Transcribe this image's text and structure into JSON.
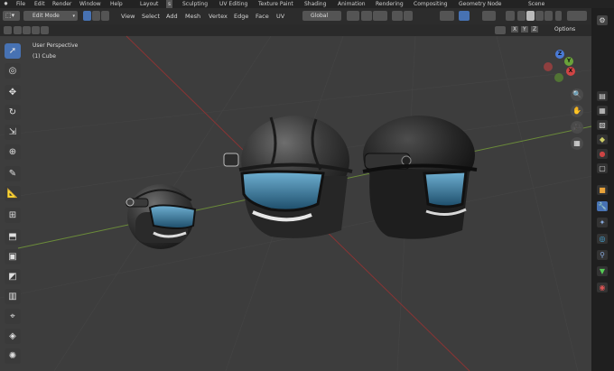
{
  "topbar": {
    "menus": [
      "File",
      "Edit",
      "Render",
      "Window",
      "Help"
    ],
    "workspaces": [
      "Layout",
      "Sculpting",
      "UV Editing",
      "Texture Paint",
      "Shading",
      "Animation",
      "Rendering",
      "Compositing",
      "Geometry Node"
    ],
    "workspace_extra": "s",
    "scene_label": "Scene"
  },
  "header": {
    "mode": "Edit Mode",
    "menus": [
      "View",
      "Select",
      "Add",
      "Mesh",
      "Vertex",
      "Edge",
      "Face",
      "UV"
    ],
    "transform": "Global"
  },
  "subheader": {
    "axes": [
      "X",
      "Y",
      "Z"
    ],
    "options": "Options"
  },
  "viewport": {
    "perspective": "User Perspective",
    "object": "(1) Cube"
  },
  "gizmo": {
    "x": "X",
    "y": "Y",
    "z": "Z"
  },
  "colors": {
    "accent": "#4772b3",
    "bg": "#3d3d3d",
    "grid_x": "#9a3b3b",
    "grid_y": "#6b8b3a"
  },
  "icons": {
    "tools": [
      "cursor-select-icon",
      "cursor-3d-icon",
      "move-icon",
      "rotate-icon",
      "scale-icon",
      "transform-icon",
      "annotate-icon",
      "measure-icon",
      "add-cube-icon",
      "extrude-icon",
      "inset-icon",
      "bevel-icon",
      "loop-cut-icon",
      "knife-icon",
      "poly-build-icon",
      "spin-icon"
    ]
  }
}
